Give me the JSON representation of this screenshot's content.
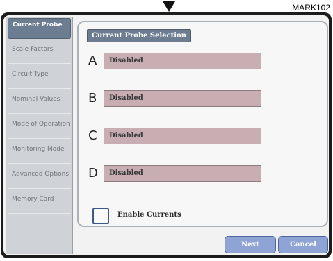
{
  "mark_label": "MARK102",
  "sidebar": {
    "items": [
      {
        "label": "Current Probe",
        "active": true
      },
      {
        "label": "Scale Factors",
        "active": false
      },
      {
        "label": "Circuit Type",
        "active": false
      },
      {
        "label": "Nominal Values",
        "active": false
      },
      {
        "label": "Mode of Operation",
        "active": false
      },
      {
        "label": "Monitoring Mode",
        "active": false
      },
      {
        "label": "Advanced Options",
        "active": false
      },
      {
        "label": "Memory Card",
        "active": false
      }
    ]
  },
  "panel": {
    "title": "Current Probe Selection",
    "probes": [
      {
        "channel": "A",
        "value": "Disabled"
      },
      {
        "channel": "B",
        "value": "Disabled"
      },
      {
        "channel": "C",
        "value": "Disabled"
      },
      {
        "channel": "D",
        "value": "Disabled"
      }
    ],
    "enable_currents_label": "Enable Currents",
    "enable_currents_checked": false
  },
  "buttons": {
    "next": "Next",
    "cancel": "Cancel"
  },
  "colors": {
    "active_tab": "#6c7d91",
    "probe_field": "#c8aeb3",
    "button": "#8fa4d4"
  }
}
